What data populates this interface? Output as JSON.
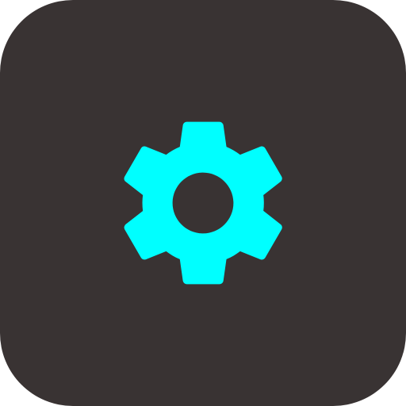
{
  "app_icon": {
    "icon": "gear-icon",
    "background_color": "#393333",
    "glyph_color": "#00FFFF"
  }
}
